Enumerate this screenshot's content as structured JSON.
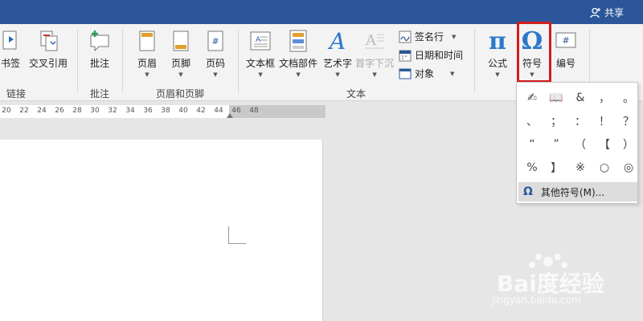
{
  "header": {
    "share_label": "共享"
  },
  "ribbon": {
    "bookmark": "书签",
    "cross_reference": "交叉引用",
    "comment": "批注",
    "header_btn": "页眉",
    "footer_btn": "页脚",
    "page_number": "页码",
    "text_box": "文本框",
    "quick_parts": "文档部件",
    "wordart": "艺术字",
    "drop_cap": "首字下沉",
    "signature_line": "签名行",
    "date_time": "日期和时间",
    "object": "对象",
    "equation": "公式",
    "symbol": "符号",
    "numbering": "编号",
    "groups": {
      "links": "链接",
      "comments": "批注",
      "header_footer": "页眉和页脚",
      "text": "文本"
    },
    "icon_glyphs": {
      "equation": "π",
      "symbol": "Ω",
      "numbering": "#",
      "wordart": "A",
      "page_number": "#"
    }
  },
  "ruler": {
    "ticks": [
      "20",
      "22",
      "24",
      "26",
      "28",
      "30",
      "32",
      "34",
      "36",
      "38",
      "40",
      "42",
      "44",
      "46",
      "48"
    ]
  },
  "symbol_dropdown": {
    "symbols": [
      "✍",
      "📖",
      "&",
      "，",
      "。",
      "、",
      "；",
      "：",
      "！",
      "？",
      "“",
      "”",
      "（",
      "【",
      "）",
      "%",
      "】",
      "※",
      "○",
      "◎"
    ],
    "more_symbols_label": "其他符号(M)...",
    "more_icon": "Ω"
  },
  "watermark": {
    "brand": "Bai度经验",
    "url": "jingyan.baidu.com"
  },
  "colors": {
    "title_bar": "#2b579a",
    "highlight_box": "#d21e1e",
    "symbol_icon": "#2b579a"
  }
}
